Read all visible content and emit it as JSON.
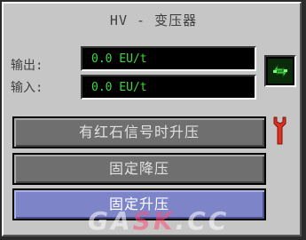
{
  "title": "HV - 变压器",
  "output": {
    "label": "输出:",
    "value": "0.0 EU/t"
  },
  "input": {
    "label": "输入:",
    "value": "0.0 EU/t"
  },
  "side_button_icon": "green-cycle-arrows-icon",
  "mode_buttons": [
    {
      "label": "有红石信号时升压",
      "active": false
    },
    {
      "label": "固定降压",
      "active": false
    },
    {
      "label": "固定升压",
      "active": true
    }
  ],
  "wrench_icon": "wrench-icon",
  "watermark": {
    "part1": "GA",
    "part2": "SK",
    "part3": ".CC"
  },
  "colors": {
    "panel": "#c6c6c6",
    "value_text": "#3cd83c",
    "button_normal": "#6f6f6f",
    "button_active": "#7d84c8",
    "wrench": "#e03020"
  }
}
